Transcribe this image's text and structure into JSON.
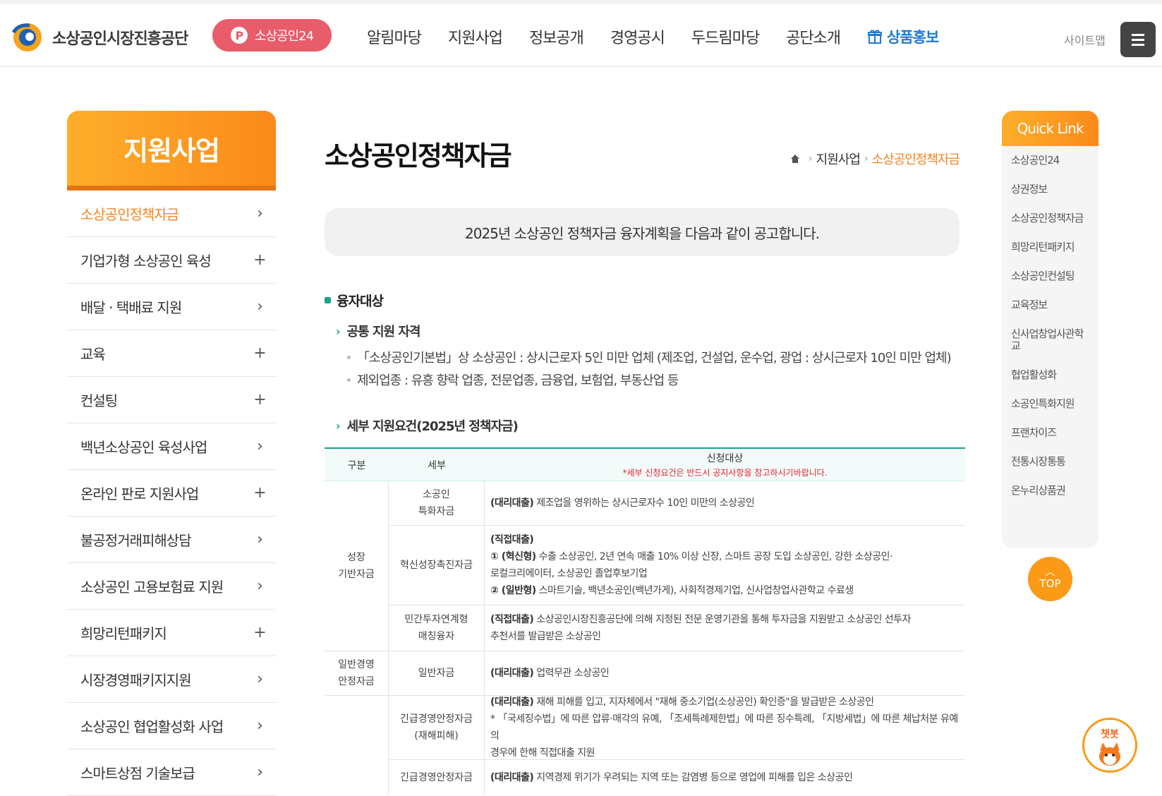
{
  "header": {
    "org_name": "소상공인시장진흥공단",
    "pill_label": "소상공인24",
    "gnb": [
      "알림마당",
      "지원사업",
      "정보공개",
      "경영공시",
      "두드림마당",
      "공단소개"
    ],
    "promo_label": "상품홍보",
    "sitemap_label": "사이트맵"
  },
  "lnb": {
    "title": "지원사업",
    "items": [
      {
        "label": "소상공인정책자금",
        "mark": "›"
      },
      {
        "label": "기업가형 소상공인 육성",
        "mark": "+"
      },
      {
        "label": "배달 · 택배료 지원",
        "mark": "›"
      },
      {
        "label": "교육",
        "mark": "+"
      },
      {
        "label": "컨설팅",
        "mark": "+"
      },
      {
        "label": "백년소상공인 육성사업",
        "mark": "›"
      },
      {
        "label": "온라인 판로 지원사업",
        "mark": "+"
      },
      {
        "label": "불공정거래피해상담",
        "mark": "›"
      },
      {
        "label": "소상공인 고용보험료 지원",
        "mark": "›"
      },
      {
        "label": "희망리턴패키지",
        "mark": "+"
      },
      {
        "label": "시장경영패키지지원",
        "mark": "›"
      },
      {
        "label": "소상공인 협업활성화 사업",
        "mark": "›"
      },
      {
        "label": "스마트상점 기술보급",
        "mark": "›"
      }
    ]
  },
  "content": {
    "title": "소상공인정책자금",
    "breadcrumb": [
      "지원사업",
      "소상공인정책자금"
    ],
    "notice": "2025년 소상공인 정책자금 융자계획을 다음과 같이 공고합니다.",
    "section": "융자대상",
    "sub1": "공통 지원 자격",
    "bullets": [
      "「소상공인기본법」상 소상공인 : 상시근로자 5인 미만 업체 (제조업, 건설업, 운수업, 광업 : 상시근로자 10인 미만 업체)",
      "제외업종 : 유흥 향락 업종, 전문업종, 금융업, 보험업, 부동산업 등"
    ],
    "sub2": "세부 지원요건(2025년 정책자금)",
    "table": {
      "h_group": "구분",
      "h_detail": "세부",
      "h_target": "신청대상",
      "h_note": "*세부 신청요건은 반드시 공지사항을 참고하시기바랍니다.",
      "group1": "성장\n기반자금",
      "group2": "일반경영\n안정자금",
      "r1_detail": "소공인\n특화자금",
      "r1_tag": "(대리대출)",
      "r1_text": " 제조업을 영위하는 상시근로자수 10인 미만의 소상공인",
      "r2_detail": "혁신성장촉진자금",
      "r2_tag": "(직접대출)",
      "r2_l1_tag": "① (혁신형)",
      "r2_l1_text": " 수출 소상공인, 2년 연속 매출 10% 이상 신장, 스마트 공장 도입 소상공인, 강한 소상공인·",
      "r2_l2_text": "로컬크리에이터, 소상공인 졸업후보기업",
      "r2_l3_tag": "② (일반형)",
      "r2_l3_text": " 스마트기술, 백년소공인(백년가게), 사회적경제기업, 신사업창업사관학교 수료생",
      "r3_detail": "민간투자연계형\n매칭융자",
      "r3_tag": "(직접대출)",
      "r3_l1_text": " 소상공인시장진흥공단에 의해 지정된 전문 운영기관을 통해 투자금을 지원받고 소상공인 선투자",
      "r3_l2_text": "추천서를 발급받은 소상공인",
      "r4_detail": "일반자금",
      "r4_tag": "(대리대출)",
      "r4_text": " 업력무관 소상공인",
      "r5_detail": "긴급경영안정자금\n(재해피해)",
      "r5_tag": "(대리대출)",
      "r5_l1_text": " 재해 피해를 입고, 지자체에서 \"재해 중소기업(소상공인) 확인증\"을 발급받은 소상공인",
      "r5_l2_text": "* 「국세징수법」에 따른 압류·매각의 유예, 「조세특례제한법」에 따른 징수특례, 「지방세법」에 따른 체납처분 유예의",
      "r5_l3_text": "경우에 한해 직접대출 지원",
      "r6_detail": "긴급경영안정자금",
      "r6_tag": "(대리대출)",
      "r6_text": " 지역경제 위기가 우려되는 지역 또는 감염병 등으로 영업에 피해를 입은 소상공인"
    }
  },
  "quick": {
    "title": "Quick Link",
    "items": [
      "소상공인24",
      "상권정보",
      "소상공인정책자금",
      "희망리턴패키지",
      "소상공인컨설팅",
      "교육정보",
      "신사업창업사관학교",
      "협업활성화",
      "소공인특화지원",
      "프랜차이즈",
      "전통시장통통",
      "온누리상품권"
    ]
  },
  "top_label": "TOP",
  "chatbot_label": "챗봇",
  "colors": {
    "accent_orange": "#fb8a1a",
    "teal": "#1aa38d",
    "pill_red": "#e95c6a",
    "promo_blue": "#1f7ad1"
  }
}
